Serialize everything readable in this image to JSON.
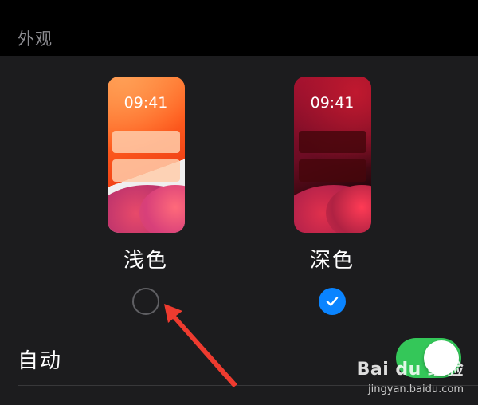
{
  "section": {
    "title": "外观"
  },
  "appearance": {
    "options": [
      {
        "label": "浅色",
        "preview_time": "09:41",
        "selected": false
      },
      {
        "label": "深色",
        "preview_time": "09:41",
        "selected": true
      }
    ]
  },
  "automatic": {
    "label": "自动",
    "enabled": true
  },
  "colors": {
    "background": "#000000",
    "panel": "#1c1c1e",
    "accent_blue": "#0a84ff",
    "toggle_green": "#34c759",
    "annotation_red": "#ee3b2f"
  },
  "watermark": {
    "brand": "Bai du 经验",
    "site": "jingyan.baidu.com"
  }
}
